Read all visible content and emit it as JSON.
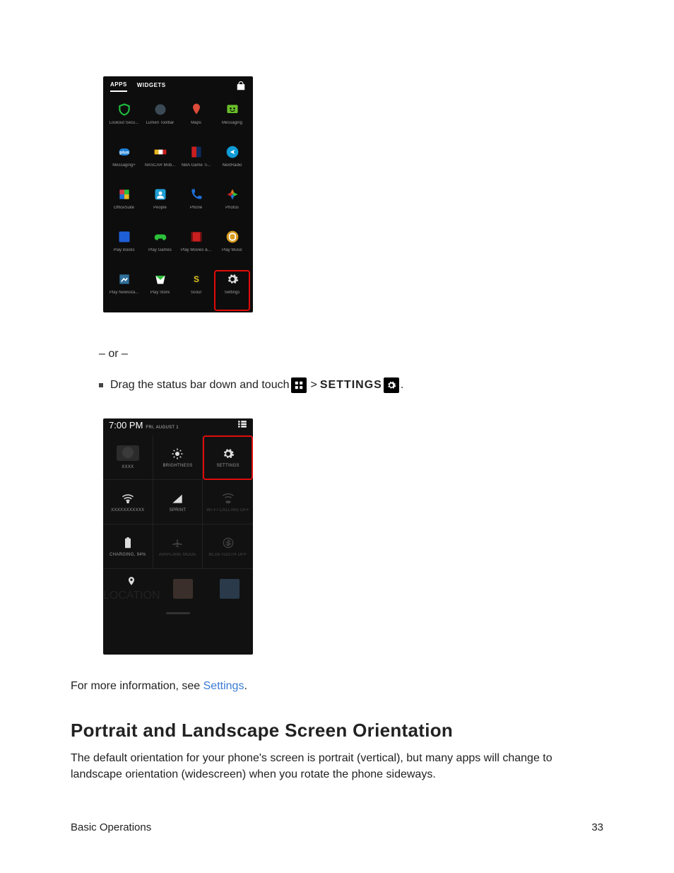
{
  "apps_screenshot": {
    "tabs": {
      "apps": "APPS",
      "widgets": "WIDGETS"
    },
    "apps": [
      {
        "label": "Lookout Secu...",
        "icon": "shield",
        "color": "#1fbf3f"
      },
      {
        "label": "Lumen Toolbar",
        "icon": "globe",
        "color": "#3b4a55"
      },
      {
        "label": "Maps",
        "icon": "maps",
        "color": "#de4b39"
      },
      {
        "label": "Messaging",
        "icon": "smile",
        "color": "#6abf2a"
      },
      {
        "label": "Messaging+",
        "icon": "plus",
        "color": "#1d7fd6"
      },
      {
        "label": "NASCAR Mob...",
        "icon": "nascar",
        "color": "#c91f1f"
      },
      {
        "label": "NBA Game Ti...",
        "icon": "nba",
        "color": "#0b2b5a"
      },
      {
        "label": "NextRadio",
        "icon": "radio",
        "color": "#0e9bd6"
      },
      {
        "label": "OfficeSuite",
        "icon": "office",
        "color": "#d63b4a"
      },
      {
        "label": "People",
        "icon": "people",
        "color": "#1f9fd6"
      },
      {
        "label": "Phone",
        "icon": "phone",
        "color": "#1f6fd6"
      },
      {
        "label": "Photos",
        "icon": "photos",
        "color": "#d6771f"
      },
      {
        "label": "Play Books",
        "icon": "books",
        "color": "#1f5fd6"
      },
      {
        "label": "Play Games",
        "icon": "games",
        "color": "#2cbf3a"
      },
      {
        "label": "Play Movies &...",
        "icon": "movies",
        "color": "#c91f1f"
      },
      {
        "label": "Play Music",
        "icon": "music",
        "color": "#d69b1f"
      },
      {
        "label": "Play Newssta...",
        "icon": "news",
        "color": "#2f6f9b"
      },
      {
        "label": "Play Store",
        "icon": "store",
        "color": "#ffffff"
      },
      {
        "label": "Scout",
        "icon": "scout",
        "color": "#e5c81f"
      },
      {
        "label": "Settings",
        "icon": "gear",
        "color": "#4a4a4a",
        "highlight": true
      }
    ]
  },
  "or_text": "– or –",
  "instruction": {
    "prefix": "Drag the status bar down and touch ",
    "settings_word": "SETTINGS",
    "period": "."
  },
  "notification_panel": {
    "time": "7:00 PM",
    "date": "FRI, AUGUST 1",
    "tiles": [
      {
        "label": "XXXX",
        "type": "avatar"
      },
      {
        "label": "BRIGHTNESS",
        "icon": "brightness"
      },
      {
        "label": "SETTINGS",
        "icon": "gear",
        "highlight": true
      },
      {
        "label": "XXXXXXXXXXX",
        "icon": "wifi"
      },
      {
        "label": "SPRINT",
        "icon": "signal"
      },
      {
        "label": "WI-FI CALLING OFF",
        "icon": "wificall",
        "dim": true
      },
      {
        "label": "CHARGING, 94%",
        "icon": "battery"
      },
      {
        "label": "AIRPLANE MODE",
        "icon": "airplane",
        "dim": true
      },
      {
        "label": "BLUETOOTH OFF",
        "icon": "bluetooth",
        "dim": true
      }
    ],
    "bottom": [
      {
        "label": "LOCATION",
        "icon": "location"
      }
    ]
  },
  "info_line": {
    "prefix": "For more information, see ",
    "link": "Settings",
    "suffix": "."
  },
  "heading": "Portrait and Landscape Screen Orientation",
  "body": "The default orientation for your phone's screen is portrait (vertical), but many apps will change to landscape orientation (widescreen) when you rotate the phone sideways.",
  "footer": {
    "left": "Basic Operations",
    "right": "33"
  }
}
